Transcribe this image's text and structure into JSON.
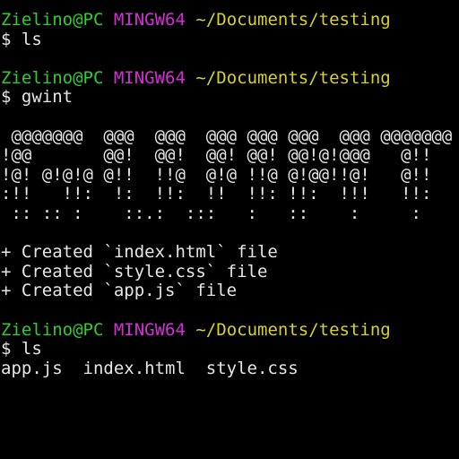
{
  "colors": {
    "background": "#000000",
    "text": "#e6e6e6",
    "user": "#2fce2f",
    "env": "#d42fd4",
    "path": "#d7d22b"
  },
  "prompt": {
    "user_host": "Zielino@PC",
    "env": "MINGW64",
    "path": "~/Documents/testing",
    "symbol": "$"
  },
  "commands": {
    "first": "ls",
    "second": "gwint",
    "third": "ls"
  },
  "banner": [
    " @@@@@@@  @@@  @@@  @@@ @@@ @@@  @@@ @@@@@@@",
    "!@@       @@!  @@!  @@! @@! @@!@!@@@   @!!",
    "!@! @!@!@ @!!  !!@  @!@ !!@ @!@@!!@!   @!!",
    ":!!   !!:  !:  !!:  !!  !!: !!:  !!!   !!:",
    " :: :: :    ::.:  :::   :   ::    :     :"
  ],
  "created_files": [
    "+ Created `index.html` file",
    "+ Created `style.css` file",
    "+ Created `app.js` file"
  ],
  "ls_output": "app.js  index.html  style.css"
}
